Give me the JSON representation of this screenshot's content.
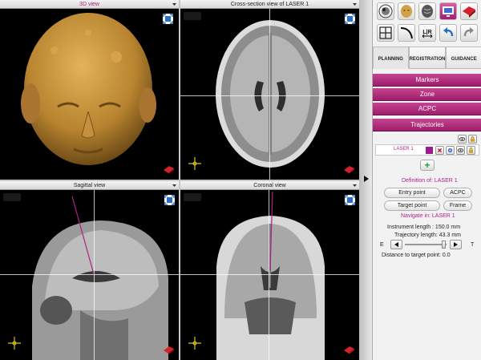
{
  "views": {
    "v3d": {
      "title": "3D view"
    },
    "axial": {
      "title": "Cross-section view of LASER 1"
    },
    "sagittal": {
      "title": "Sagittal view"
    },
    "coronal": {
      "title": "Coronal view"
    }
  },
  "tabs": [
    {
      "label": "PLANNING",
      "active": true
    },
    {
      "label": "REGISTRATION",
      "active": false
    },
    {
      "label": "GUIDANCE",
      "active": false
    }
  ],
  "toolbar": {
    "row1": [
      "brain-slices-icon",
      "head-icon",
      "brain-icon",
      "monitor-icon",
      "red-cube-icon"
    ],
    "row2": [
      "layout-grid-icon",
      "curve-icon",
      "lr-flip-icon",
      "undo-icon",
      "redo-icon"
    ],
    "lr_label": "L|R"
  },
  "sections": {
    "markers": "Markers",
    "zone": "Zone",
    "acpc": "ACPC",
    "trajectories": "Trajectories"
  },
  "trajectory": {
    "name": "LASER 1",
    "color": "#9b1a8e",
    "add_symbol": "+",
    "delete_symbol": "✕"
  },
  "definition": {
    "title": "Definition of: LASER 1",
    "entry_point": "Entry point",
    "acpc": "ACPC",
    "target_point": "Target point",
    "frame": "Frame"
  },
  "navigate": {
    "title": "Navigate in: LASER 1",
    "instrument_length": "Instrument length : 150.0 mm",
    "trajectory_length": "Trajectory length: 43.3 mm",
    "left_label": "E",
    "right_label": "T",
    "distance": "Distance to target point: 0.0"
  },
  "colors": {
    "accent": "#b0208a",
    "section_bg": "#b23182",
    "skin": "#c9963d"
  }
}
